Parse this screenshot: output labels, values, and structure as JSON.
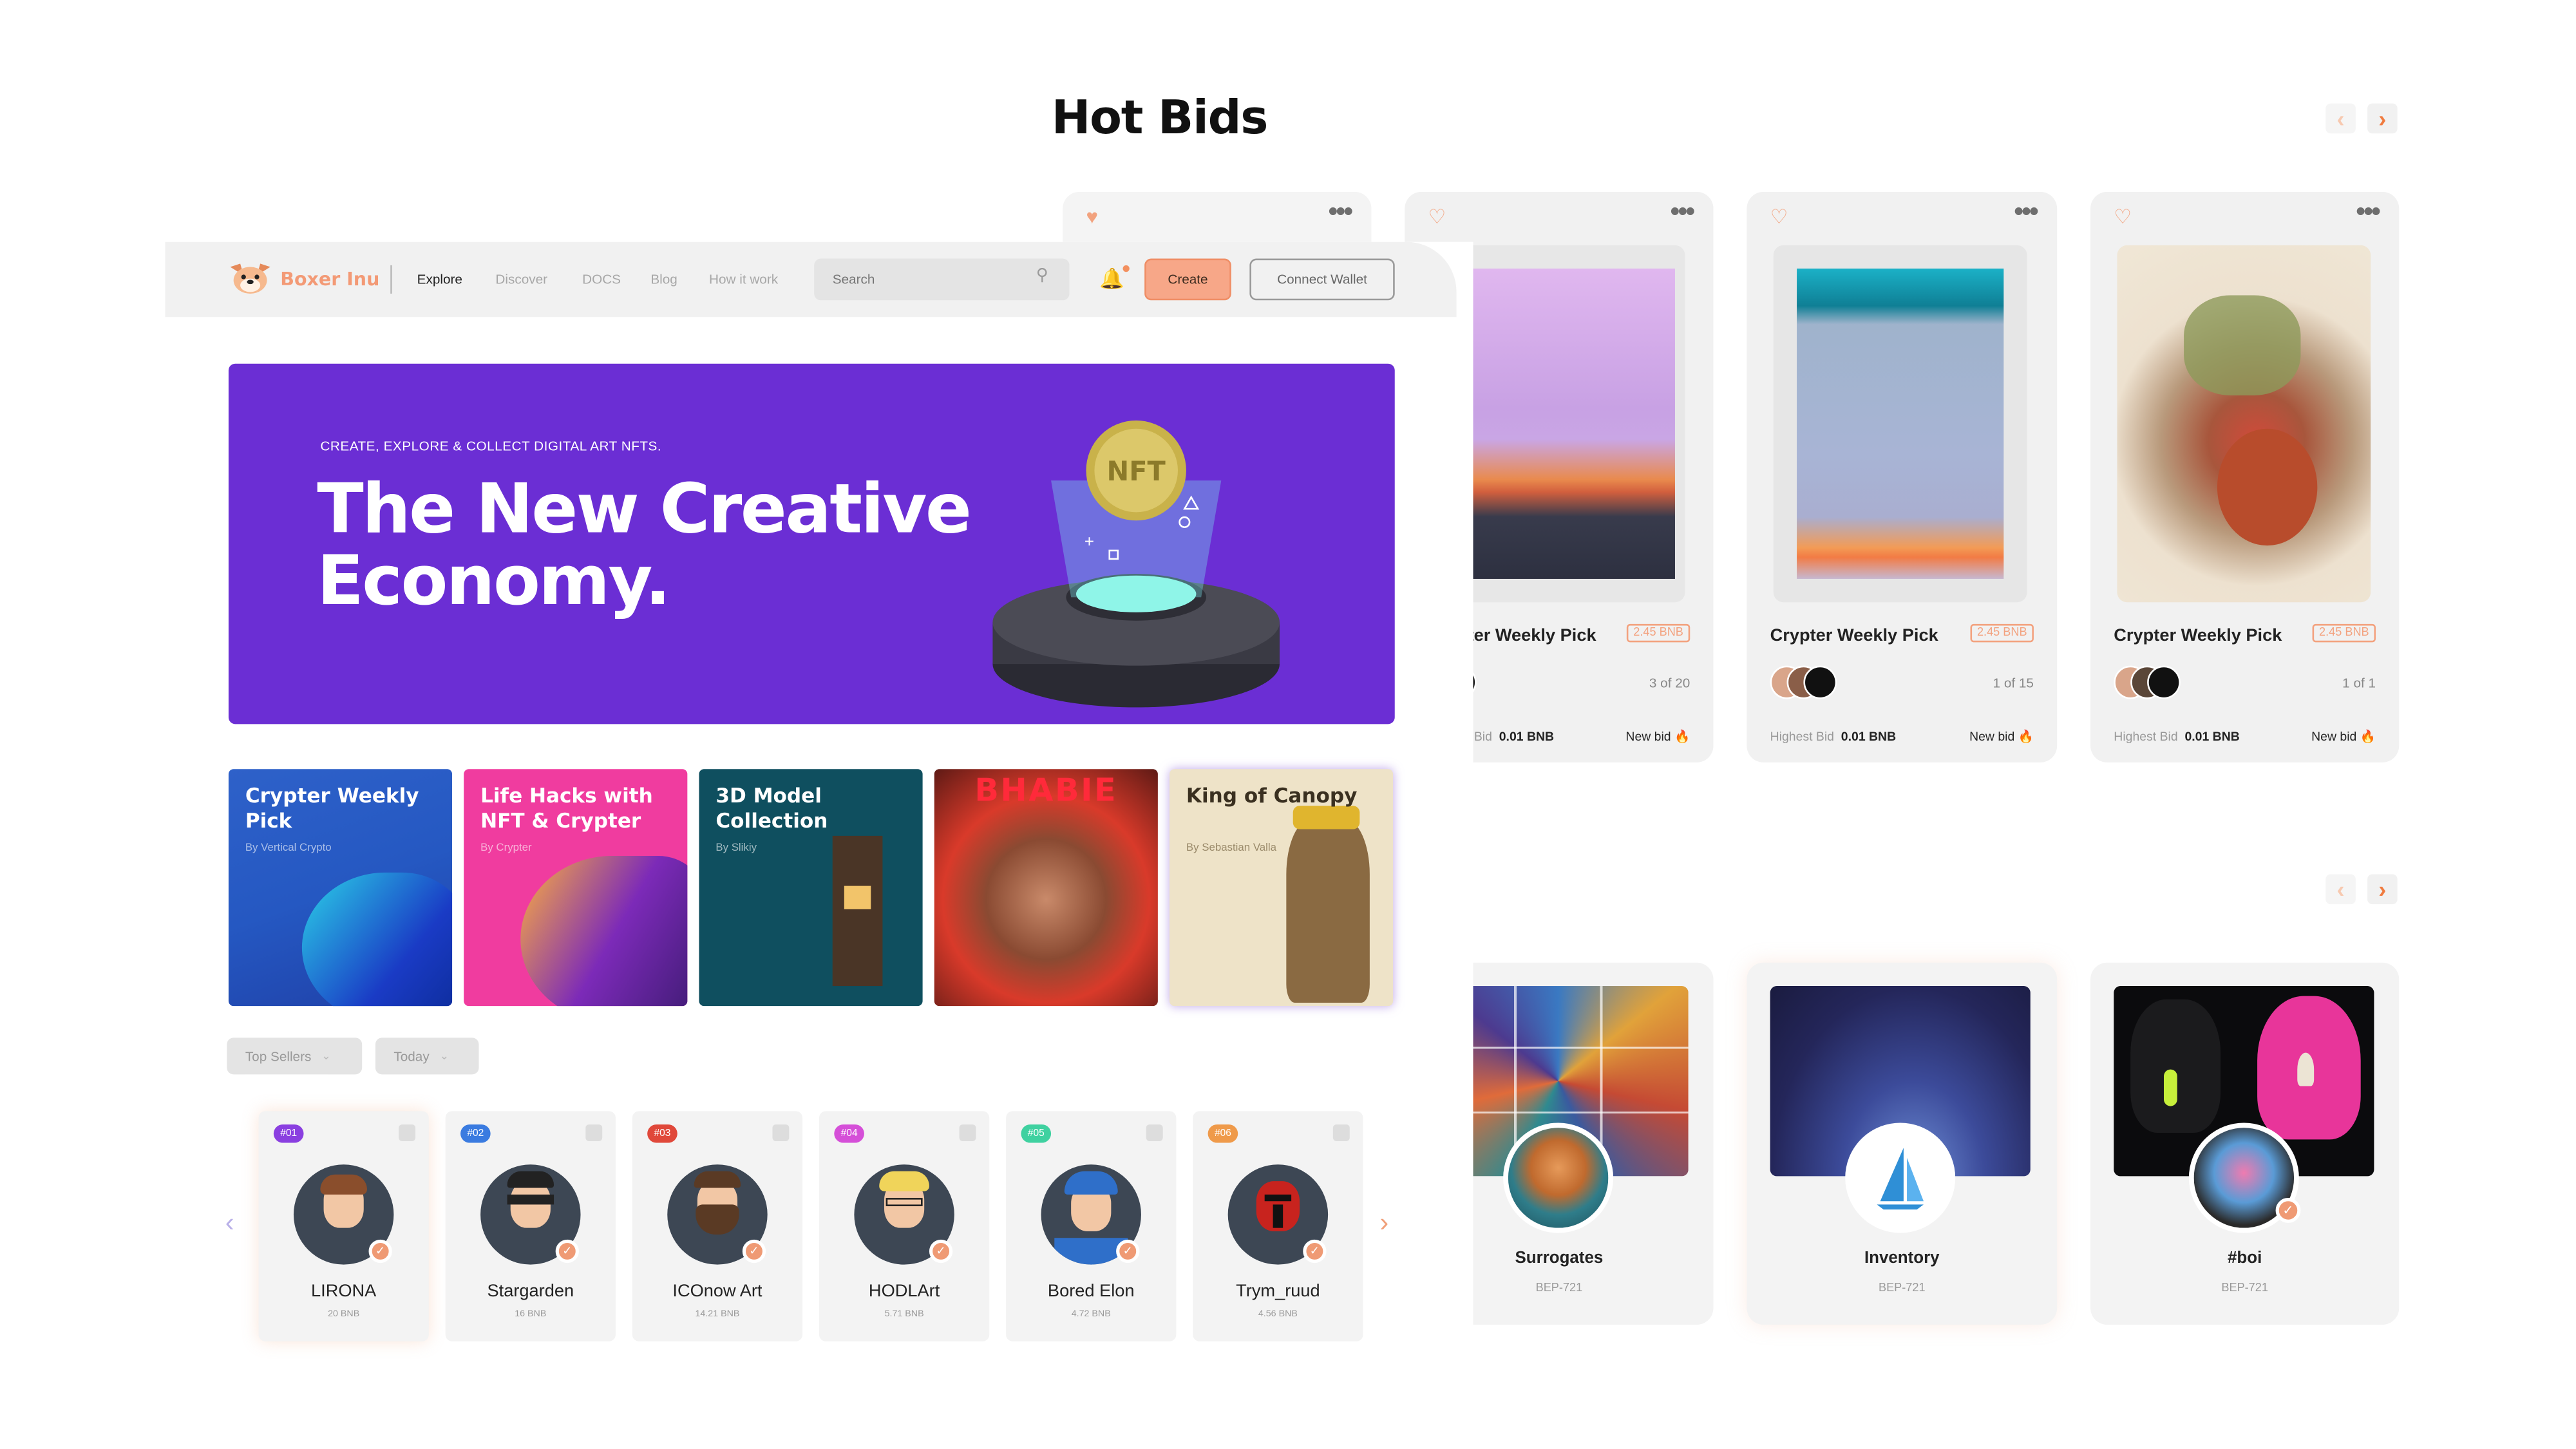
{
  "title": "Hot Bids",
  "nav_arrows": {
    "prev": "‹",
    "next": "›"
  },
  "hot_bids": [
    {
      "name": "Crypter Weekly Pick",
      "price": "2.45 BNB",
      "count": "3 of 20",
      "bid_label": "Highest Bid",
      "bid_value": "0.01 BNB",
      "new_bid": "New bid"
    },
    {
      "name": "Crypter Weekly Pick",
      "price": "2.45 BNB",
      "count": "1 of 15",
      "bid_label": "Highest Bid",
      "bid_value": "0.01 BNB",
      "new_bid": "New bid"
    },
    {
      "name": "Crypter Weekly Pick",
      "price": "2.45 BNB",
      "count": "1 of 1",
      "bid_label": "Highest Bid",
      "bid_value": "0.01 BNB",
      "new_bid": "New bid"
    }
  ],
  "collections": [
    {
      "name": "Surrogates",
      "standard": "BEP-721"
    },
    {
      "name": "Inventory",
      "standard": "BEP-721"
    },
    {
      "name": "#boi",
      "standard": "BEP-721"
    }
  ],
  "header": {
    "logo": "Boxer Inu",
    "links": [
      "Explore",
      "Discover",
      "DOCS",
      "Blog",
      "How it work"
    ],
    "search_placeholder": "Search",
    "create": "Create",
    "connect": "Connect Wallet"
  },
  "hero": {
    "kicker": "CREATE, EXPLORE & COLLECT DIGITAL ART NFTS.",
    "headline": "The New Creative Economy.",
    "coin_label": "NFT"
  },
  "featured": [
    {
      "title": "Crypter Weekly Pick",
      "by": "By Vertical Crypto"
    },
    {
      "title": "Life Hacks with NFT & Crypter",
      "by": "By Crypter"
    },
    {
      "title": "3D Model Collection",
      "by": "By Slikiy"
    },
    {
      "title": "",
      "by": "",
      "art_text": "BHABIE"
    },
    {
      "title": "King of Canopy",
      "by": "By Sebastian Valla"
    }
  ],
  "filters": {
    "sort": "Top Sellers",
    "period": "Today"
  },
  "sellers": [
    {
      "rank": "#01",
      "name": "LIRONA",
      "amount": "20 BNB",
      "color": "#8a3fe0"
    },
    {
      "rank": "#02",
      "name": "Stargarden",
      "amount": "16 BNB",
      "color": "#3a7be0"
    },
    {
      "rank": "#03",
      "name": "ICOnow Art",
      "amount": "14.21 BNB",
      "color": "#e0483a"
    },
    {
      "rank": "#04",
      "name": "HODLArt",
      "amount": "5.71 BNB",
      "color": "#d54fd8"
    },
    {
      "rank": "#05",
      "name": "Bored Elon",
      "amount": "4.72 BNB",
      "color": "#3fd1a0"
    },
    {
      "rank": "#06",
      "name": "Trym_ruud",
      "amount": "4.56 BNB",
      "color": "#ef9a4a"
    }
  ],
  "colors": {
    "accent": "#f07b3f",
    "hero_bg": "#6b2ed4"
  }
}
